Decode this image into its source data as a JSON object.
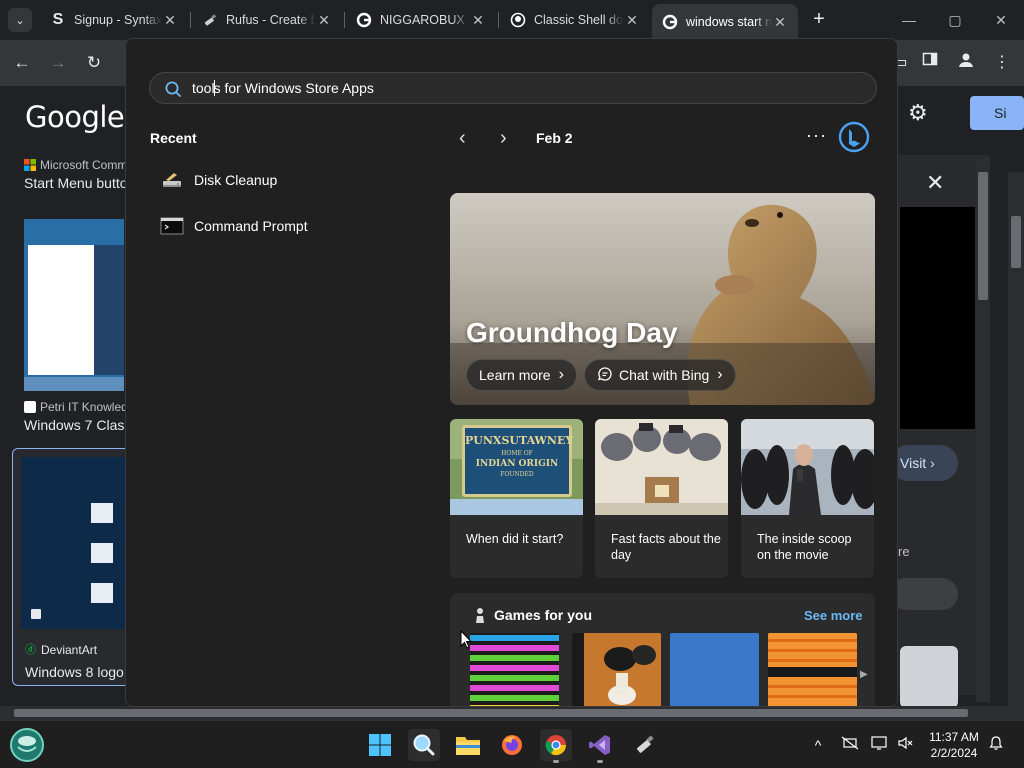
{
  "browser": {
    "tabs": [
      {
        "title": "Signup - Syntax",
        "favicon": "S"
      },
      {
        "title": "Rufus - Create bootable USB",
        "favicon": "rufus"
      },
      {
        "title": "NIGGAROBUX",
        "favicon": "google-g"
      },
      {
        "title": "Classic Shell do",
        "favicon": "github"
      },
      {
        "title": "windows start m",
        "favicon": "google-g",
        "active": true
      }
    ],
    "new_tab": "+",
    "window_controls": {
      "minimize": "—",
      "maximize": "▢",
      "close": "✕"
    }
  },
  "google_page": {
    "logo": "Google",
    "signin_label": "Si",
    "results": [
      {
        "source": "Microsoft Comm",
        "title": "Start Menu butto"
      },
      {
        "source": "Petri IT Knowled",
        "title": "Windows 7 Clas"
      },
      {
        "source": "DeviantArt",
        "title": "Windows 8 logo"
      }
    ],
    "side_panel": {
      "visit_label": "Visit",
      "partial_text": "re"
    }
  },
  "start_menu": {
    "search": {
      "typed": "tool",
      "rest": "s for Windows Store Apps"
    },
    "recent_title": "Recent",
    "recent": [
      {
        "label": "Disk Cleanup",
        "icon": "disk-cleanup-icon"
      },
      {
        "label": "Command Prompt",
        "icon": "command-prompt-icon"
      }
    ],
    "date_label": "Feb 2",
    "more": "···",
    "hero": {
      "title": "Groundhog Day",
      "learn_more": "Learn more",
      "chat_bing": "Chat with Bing"
    },
    "cards": [
      {
        "text": "When did it start?",
        "sign_top": "PUNXSUTAWNEY",
        "sign_mid": "HOME OF",
        "sign_main": "INDIAN ORIGIN",
        "sign_small": "FOUNDED"
      },
      {
        "text": "Fast facts about the day"
      },
      {
        "text": "The inside scoop on the movie"
      }
    ],
    "games": {
      "title": "Games for you",
      "see_more": "See more"
    },
    "accent": "#6cb8f6"
  },
  "taskbar": {
    "clock_time": "11:37 AM",
    "clock_date": "2/2/2024",
    "overflow": "^"
  }
}
